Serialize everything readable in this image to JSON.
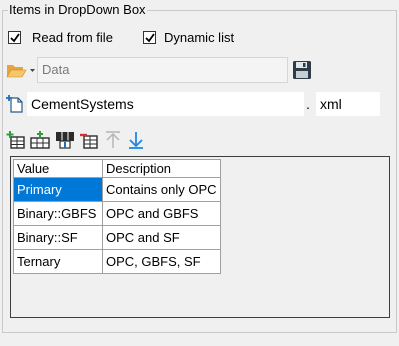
{
  "group": {
    "title": "Items in DropDown Box"
  },
  "options": {
    "read_from_file": {
      "label": "Read from file",
      "checked": true
    },
    "dynamic_list": {
      "label": "Dynamic list",
      "checked": true
    }
  },
  "path": {
    "value": "Data"
  },
  "file": {
    "name": "CementSystems",
    "separator": ".",
    "extension": "xml"
  },
  "toolbar": {
    "icons": [
      "add-row-icon",
      "insert-row-icon",
      "insert-column-icon",
      "delete-row-icon",
      "move-up-icon",
      "move-down-icon"
    ]
  },
  "table": {
    "headers": [
      "Value",
      "Description"
    ],
    "rows": [
      {
        "value": "Primary",
        "description": "Contains only OPC",
        "selected": true
      },
      {
        "value": "Binary::GBFS",
        "description": "OPC and GBFS"
      },
      {
        "value": "Binary::SF",
        "description": "OPC and SF"
      },
      {
        "value": "Ternary",
        "description": "OPC, GBFS, SF"
      }
    ]
  },
  "colors": {
    "selection": "#0078d7",
    "accent_arrow": "#1e88e5"
  }
}
